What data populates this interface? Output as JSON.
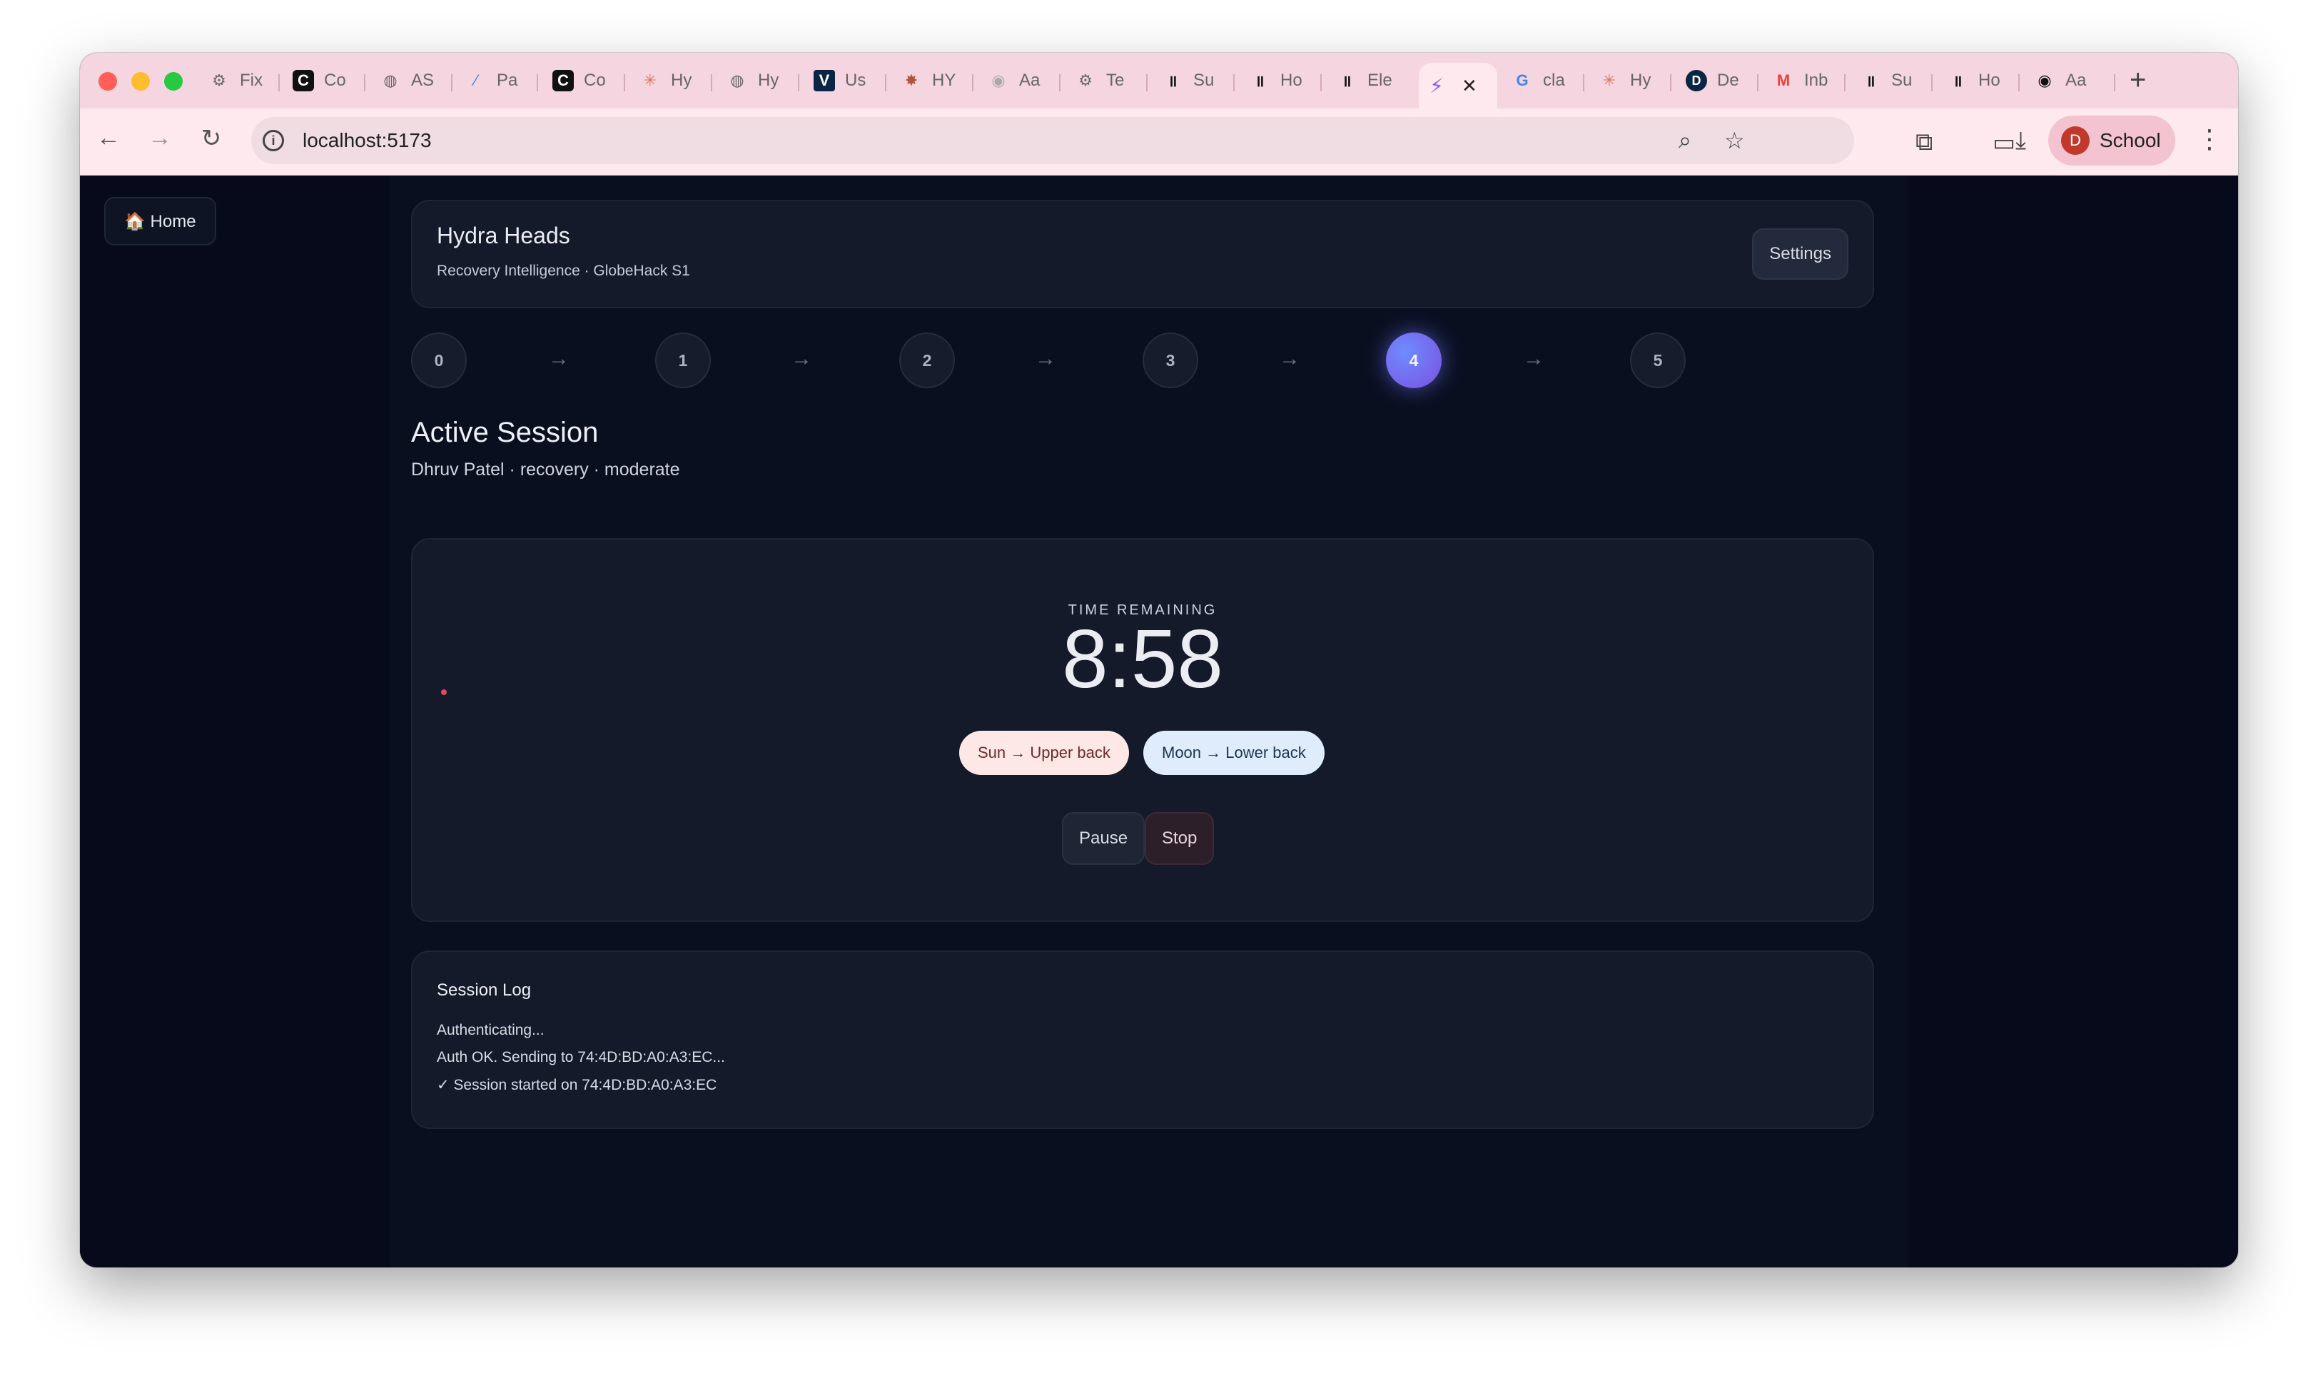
{
  "browser": {
    "tabs": [
      {
        "label": "Fix",
        "icon": "openai-icon"
      },
      {
        "label": "Co",
        "icon": "cursor-icon"
      },
      {
        "label": "AS",
        "icon": "globe-icon"
      },
      {
        "label": "Pa",
        "icon": "link-icon"
      },
      {
        "label": "Co",
        "icon": "cursor-icon"
      },
      {
        "label": "Hy",
        "icon": "claude-icon"
      },
      {
        "label": "Hy",
        "icon": "globe-icon"
      },
      {
        "label": "Us",
        "icon": "vercel-v-icon"
      },
      {
        "label": "HY",
        "icon": "claude-icon"
      },
      {
        "label": "Aa",
        "icon": "github-icon"
      },
      {
        "label": "Te",
        "icon": "openai-icon"
      },
      {
        "label": "Su",
        "icon": "pause-icon"
      },
      {
        "label": "Ho",
        "icon": "pause-icon"
      },
      {
        "label": "Ele",
        "icon": "pause-icon"
      },
      {
        "label": "",
        "icon": "vite-icon"
      },
      {
        "label": "cla",
        "icon": "google-icon"
      },
      {
        "label": "Hy",
        "icon": "claude-icon"
      },
      {
        "label": "De",
        "icon": "d-icon"
      },
      {
        "label": "Inb",
        "icon": "gmail-icon"
      },
      {
        "label": "Su",
        "icon": "pause-icon"
      },
      {
        "label": "Ho",
        "icon": "pause-icon"
      },
      {
        "label": "Aa",
        "icon": "github-icon"
      }
    ],
    "active_tab_index": 14,
    "url": "localhost:5173",
    "profile_initial": "D",
    "profile_name": "School"
  },
  "page": {
    "home_button": "🏠 Home",
    "header": {
      "title": "Hydra Heads",
      "subtitle": "Recovery Intelligence · GlobeHack S1",
      "settings_label": "Settings"
    },
    "steps": [
      "0",
      "1",
      "2",
      "3",
      "4",
      "5"
    ],
    "active_step": 4,
    "step_arrow": "→",
    "session": {
      "title": "Active Session",
      "subtitle": "Dhruv Patel · recovery · moderate"
    },
    "timer": {
      "label": "TIME REMAINING",
      "value": "8:58",
      "sun_pill": "Sun → Upper back",
      "moon_pill": "Moon → Lower back",
      "pause_label": "Pause",
      "stop_label": "Stop"
    },
    "log": {
      "title": "Session Log",
      "lines": [
        "Authenticating...",
        "Auth OK. Sending to 74:4D:BD:A0:A3:EC...",
        "✓ Session started on 74:4D:BD:A0:A3:EC"
      ]
    }
  },
  "colors": {
    "page_bg": "#060a1a",
    "card_bg": "#141a2a",
    "active_step": "#6d8cff",
    "tabstrip": "#f5d5df",
    "sun_pill": "#fde8e6",
    "moon_pill": "#deecfc"
  }
}
